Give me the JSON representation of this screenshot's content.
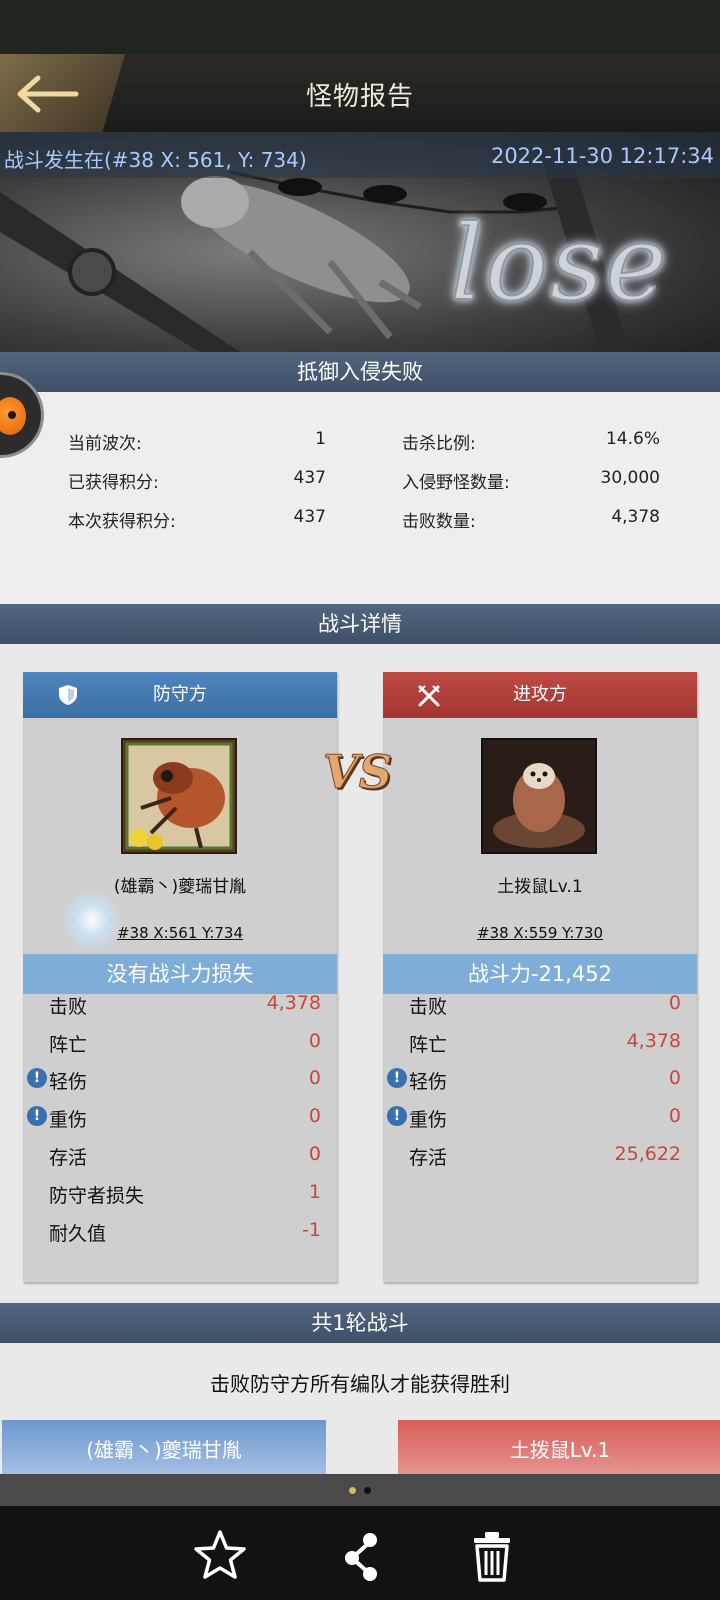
{
  "header": {
    "title": "怪物报告"
  },
  "banner": {
    "location": "战斗发生在(#38 X: 561, Y: 734)",
    "timestamp": "2022-11-30 12:17:34",
    "result_art_text": "lose"
  },
  "result_section": {
    "title": "抵御入侵失败"
  },
  "stats": {
    "left": [
      {
        "label": "当前波次:",
        "value": "1"
      },
      {
        "label": "已获得积分:",
        "value": "437"
      },
      {
        "label": "本次获得积分:",
        "value": "437"
      }
    ],
    "right": [
      {
        "label": "击杀比例:",
        "value": "14.6%"
      },
      {
        "label": "入侵野怪数量:",
        "value": "30,000"
      },
      {
        "label": "击败数量:",
        "value": "4,378"
      }
    ]
  },
  "detail_section": {
    "title": "战斗详情"
  },
  "vs_text": "VS",
  "defender": {
    "header": "防守方",
    "name": "(雄霸丶)夔瑞甘胤",
    "coords": "#38  X:561  Y:734",
    "power_text": "没有战斗力损失",
    "rows": [
      {
        "label": "击败",
        "value": "4,378",
        "info": false
      },
      {
        "label": "阵亡",
        "value": "0",
        "info": false
      },
      {
        "label": "轻伤",
        "value": "0",
        "info": true
      },
      {
        "label": "重伤",
        "value": "0",
        "info": true
      },
      {
        "label": "存活",
        "value": "0",
        "info": false
      },
      {
        "label": "防守者损失",
        "value": "1",
        "info": false
      },
      {
        "label": "耐久值",
        "value": "-1",
        "info": false
      }
    ]
  },
  "attacker": {
    "header": "进攻方",
    "name": "土拨鼠Lv.1",
    "coords": "#38  X:559  Y:730",
    "power_text": "战斗力-21,452",
    "rows": [
      {
        "label": "击败",
        "value": "0",
        "info": false
      },
      {
        "label": "阵亡",
        "value": "4,378",
        "info": false
      },
      {
        "label": "轻伤",
        "value": "0",
        "info": true
      },
      {
        "label": "重伤",
        "value": "0",
        "info": true
      },
      {
        "label": "存活",
        "value": "25,622",
        "info": false
      }
    ]
  },
  "rounds_section": {
    "title": "共1轮战斗"
  },
  "rounds_note": "击败防守方所有编队才能获得胜利",
  "round_cards": {
    "defender_label": "(雄霸丶)夔瑞甘胤",
    "attacker_label": "土拨鼠Lv.1"
  },
  "pager": {
    "current": 1,
    "total": 2
  },
  "bottom_actions": [
    "star-icon",
    "share-icon",
    "trash-icon"
  ],
  "colors": {
    "defender": "#3b6fa4",
    "attacker": "#a33631",
    "loss_value": "#c9463d",
    "section_bar": "#4a5c73"
  }
}
